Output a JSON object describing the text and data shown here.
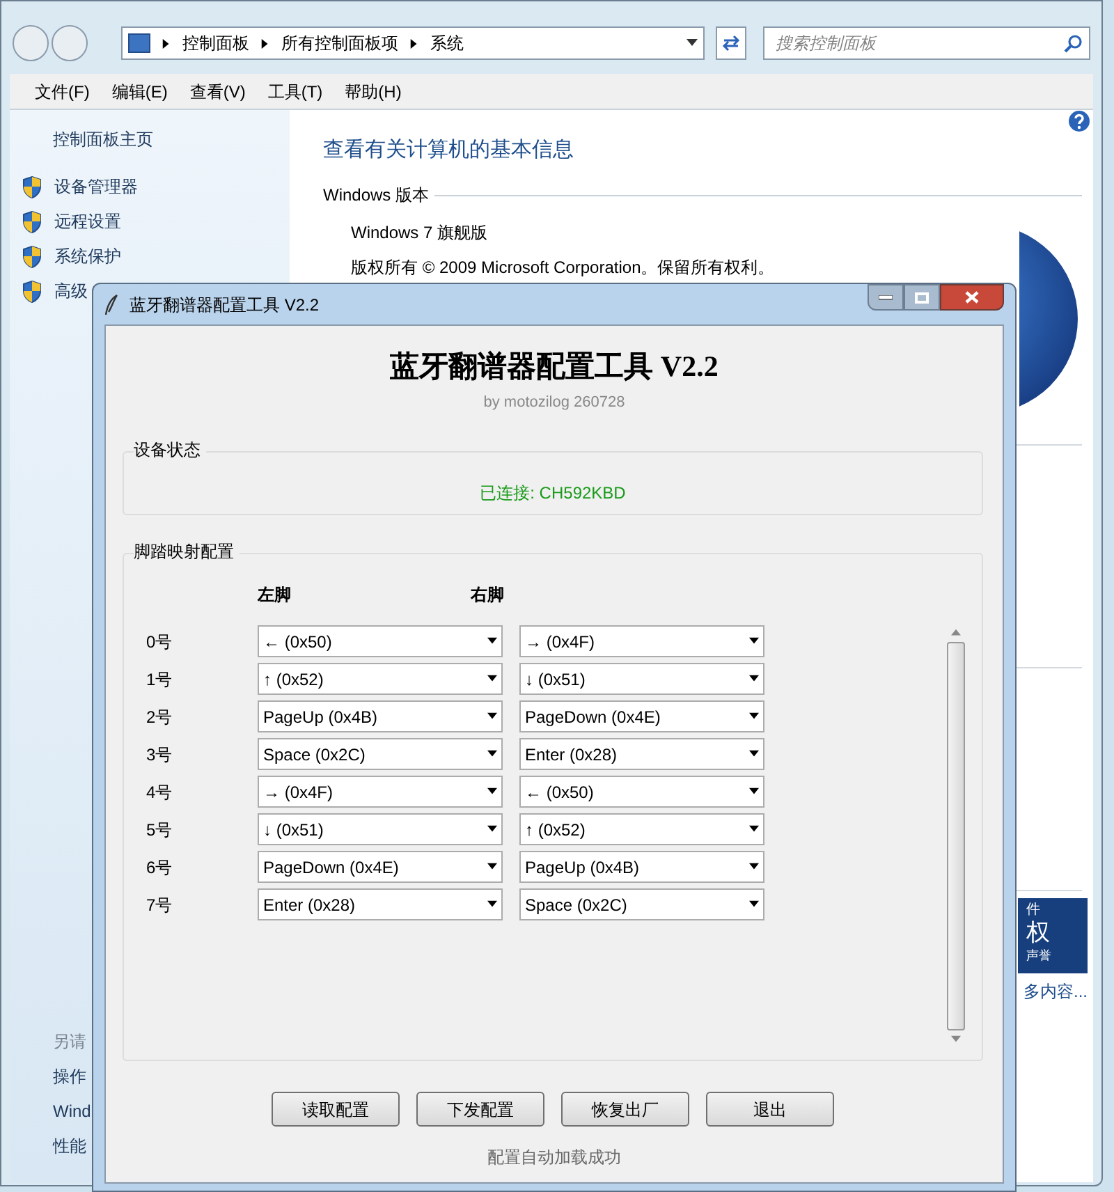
{
  "explorer": {
    "breadcrumb": [
      "控制面板",
      "所有控制面板项",
      "系统"
    ],
    "search": {
      "placeholder": "搜索控制面板"
    },
    "menu": [
      "文件(F)",
      "编辑(E)",
      "查看(V)",
      "工具(T)",
      "帮助(H)"
    ],
    "sidebar": {
      "home": "控制面板主页",
      "tasks": [
        "设备管理器",
        "远程设置",
        "系统保护",
        "高级"
      ],
      "see_also_title": "另请",
      "see_also": [
        "操作",
        "Wind",
        "性能"
      ]
    },
    "content": {
      "title": "查看有关计算机的基本信息",
      "section": "Windows 版本",
      "edition": "Windows 7 旗舰版",
      "copyright": "版权所有 © 2009 Microsoft Corporation。保留所有权利。"
    },
    "banner": {
      "line_1": "件",
      "line_2": "权",
      "line_3": "声誉",
      "link": "多内容..."
    }
  },
  "dialog": {
    "title": "蓝牙翻谱器配置工具 V2.2",
    "heading": "蓝牙翻谱器配置工具 V2.2",
    "subtitle": "by motozilog 260728",
    "status_group": {
      "label": "设备状态",
      "status": "已连接: CH592KBD",
      "connected": true
    },
    "mapping_group": {
      "label": "脚踏映射配置",
      "columns": [
        "左脚",
        "右脚"
      ],
      "rows": [
        {
          "label": "0号",
          "left": "← (0x50)",
          "right": "→ (0x4F)"
        },
        {
          "label": "1号",
          "left": "↑ (0x52)",
          "right": "↓ (0x51)"
        },
        {
          "label": "2号",
          "left": "PageUp (0x4B)",
          "right": "PageDown (0x4E)"
        },
        {
          "label": "3号",
          "left": "Space (0x2C)",
          "right": "Enter (0x28)"
        },
        {
          "label": "4号",
          "left": "→ (0x4F)",
          "right": "← (0x50)"
        },
        {
          "label": "5号",
          "left": "↓ (0x51)",
          "right": "↑ (0x52)"
        },
        {
          "label": "6号",
          "left": "PageDown (0x4E)",
          "right": "PageUp (0x4B)"
        },
        {
          "label": "7号",
          "left": "Enter (0x28)",
          "right": "Space (0x2C)"
        }
      ]
    },
    "buttons": [
      "读取配置",
      "下发配置",
      "恢复出厂",
      "退出"
    ],
    "status_text": "配置自动加载成功"
  }
}
